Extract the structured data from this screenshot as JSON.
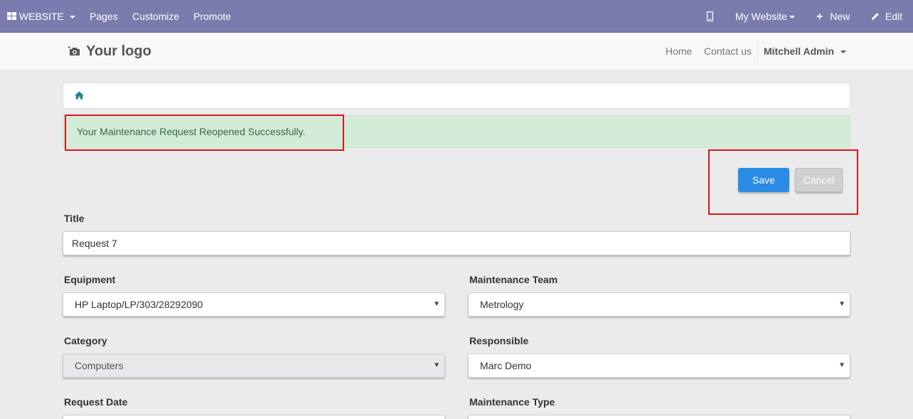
{
  "topbar": {
    "app_menu": "WEBSITE",
    "pages": "Pages",
    "customize": "Customize",
    "promote": "Promote",
    "my_website": "My Website",
    "new": "New",
    "edit": "Edit"
  },
  "header": {
    "logo_text": "Your logo",
    "home": "Home",
    "contact": "Contact us",
    "user": "Mitchell Admin"
  },
  "alert": {
    "message": "Your Maintenance Request Reopened Successfully."
  },
  "actions": {
    "save": "Save",
    "cancel": "Cancel"
  },
  "form": {
    "title": {
      "label": "Title",
      "value": "Request 7"
    },
    "equipment": {
      "label": "Equipment",
      "value": "HP Laptop/LP/303/28292090"
    },
    "team": {
      "label": "Maintenance Team",
      "value": "Metrology"
    },
    "category": {
      "label": "Category",
      "value": "Computers"
    },
    "responsible": {
      "label": "Responsible",
      "value": "Marc Demo"
    },
    "request_date": {
      "label": "Request Date",
      "value": ""
    },
    "maintenance_type": {
      "label": "Maintenance Type",
      "value": ""
    }
  },
  "colors": {
    "topbar": "#7c7bad",
    "accent": "#2a8be4",
    "alert_bg": "#d3ecd8",
    "highlight": "#e0101a"
  }
}
